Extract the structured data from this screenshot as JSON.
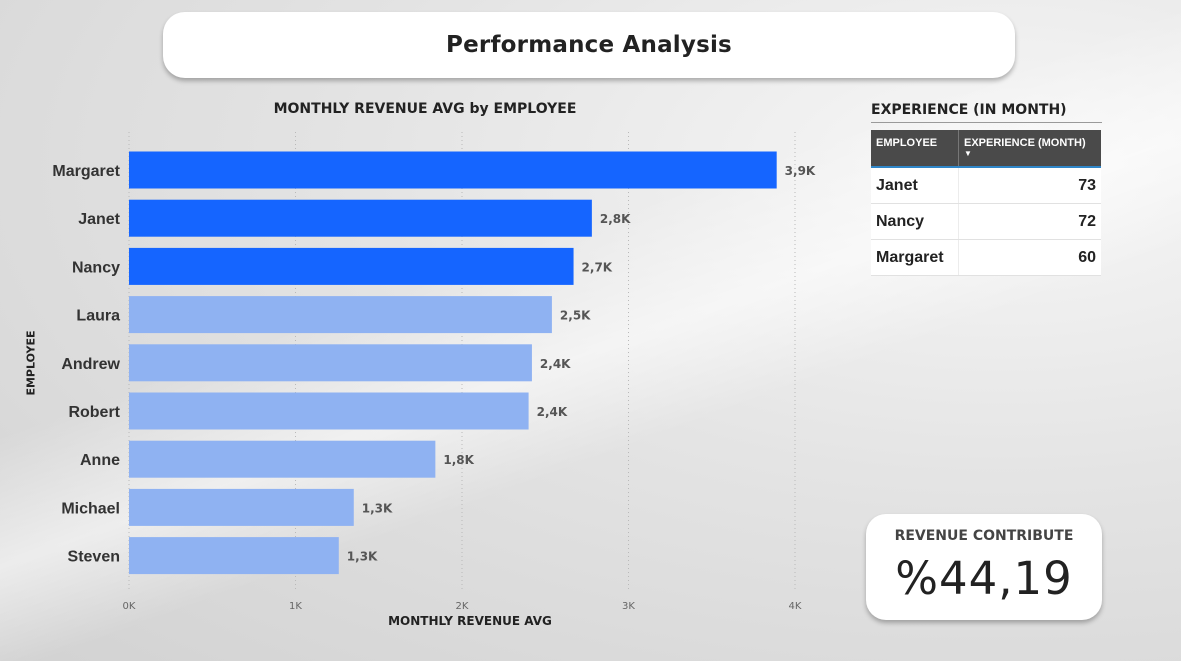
{
  "page": {
    "title": "Performance Analysis"
  },
  "bar_chart": {
    "title": "MONTHLY REVENUE AVG by EMPLOYEE"
  },
  "chart_data": {
    "type": "bar",
    "orientation": "horizontal",
    "title": "MONTHLY REVENUE AVG by EMPLOYEE",
    "xlabel": "MONTHLY REVENUE AVG",
    "ylabel": "EMPLOYEE",
    "categories": [
      "Margaret",
      "Janet",
      "Nancy",
      "Laura",
      "Andrew",
      "Robert",
      "Anne",
      "Michael",
      "Steven"
    ],
    "values": [
      3890,
      2780,
      2670,
      2540,
      2420,
      2400,
      1840,
      1350,
      1260
    ],
    "data_labels": [
      "3,9K",
      "2,8K",
      "2,7K",
      "2,5K",
      "2,4K",
      "2,4K",
      "1,8K",
      "1,3K",
      "1,3K"
    ],
    "highlighted": [
      true,
      true,
      true,
      false,
      false,
      false,
      false,
      false,
      false
    ],
    "xlim": [
      0,
      4000
    ],
    "xticks": [
      0,
      1000,
      2000,
      3000,
      4000
    ],
    "xtick_labels": [
      "0K",
      "1K",
      "2K",
      "3K",
      "4K"
    ],
    "grid": true,
    "colors": {
      "highlight": "#1565ff",
      "normal": "#8fb2f2"
    }
  },
  "experience_table": {
    "title": "EXPERIENCE (IN MONTH)",
    "columns": [
      "EMPLOYEE",
      "EXPERIENCE (MONTH)"
    ],
    "sort_icon": "caret-down-icon",
    "rows": [
      {
        "employee": "Janet",
        "experience": "73"
      },
      {
        "employee": "Nancy",
        "experience": "72"
      },
      {
        "employee": "Margaret",
        "experience": "60"
      }
    ]
  },
  "kpi": {
    "label": "REVENUE CONTRIBUTE",
    "value": "%44,19"
  }
}
